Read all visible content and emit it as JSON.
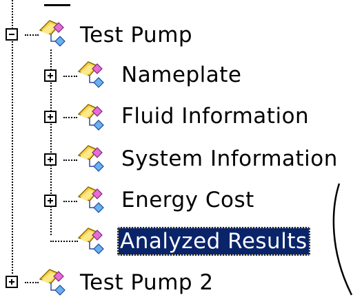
{
  "tree": {
    "root": {
      "label": "Test Pump",
      "expander": "minus"
    },
    "children": [
      {
        "label": "Nameplate",
        "expander": "plus"
      },
      {
        "label": "Fluid Information",
        "expander": "plus"
      },
      {
        "label": "System Information",
        "expander": "plus"
      },
      {
        "label": "Energy Cost",
        "expander": "plus"
      },
      {
        "label": "Analyzed Results",
        "expander": "none",
        "selected": true
      }
    ],
    "sibling": {
      "label": "Test Pump 2",
      "expander": "plus"
    }
  },
  "colors": {
    "selection_background": "#0a246a",
    "selection_text": "#ffffff",
    "focus_outline": "#f2d27a"
  },
  "icons": {
    "node": "pump-component-icon"
  }
}
